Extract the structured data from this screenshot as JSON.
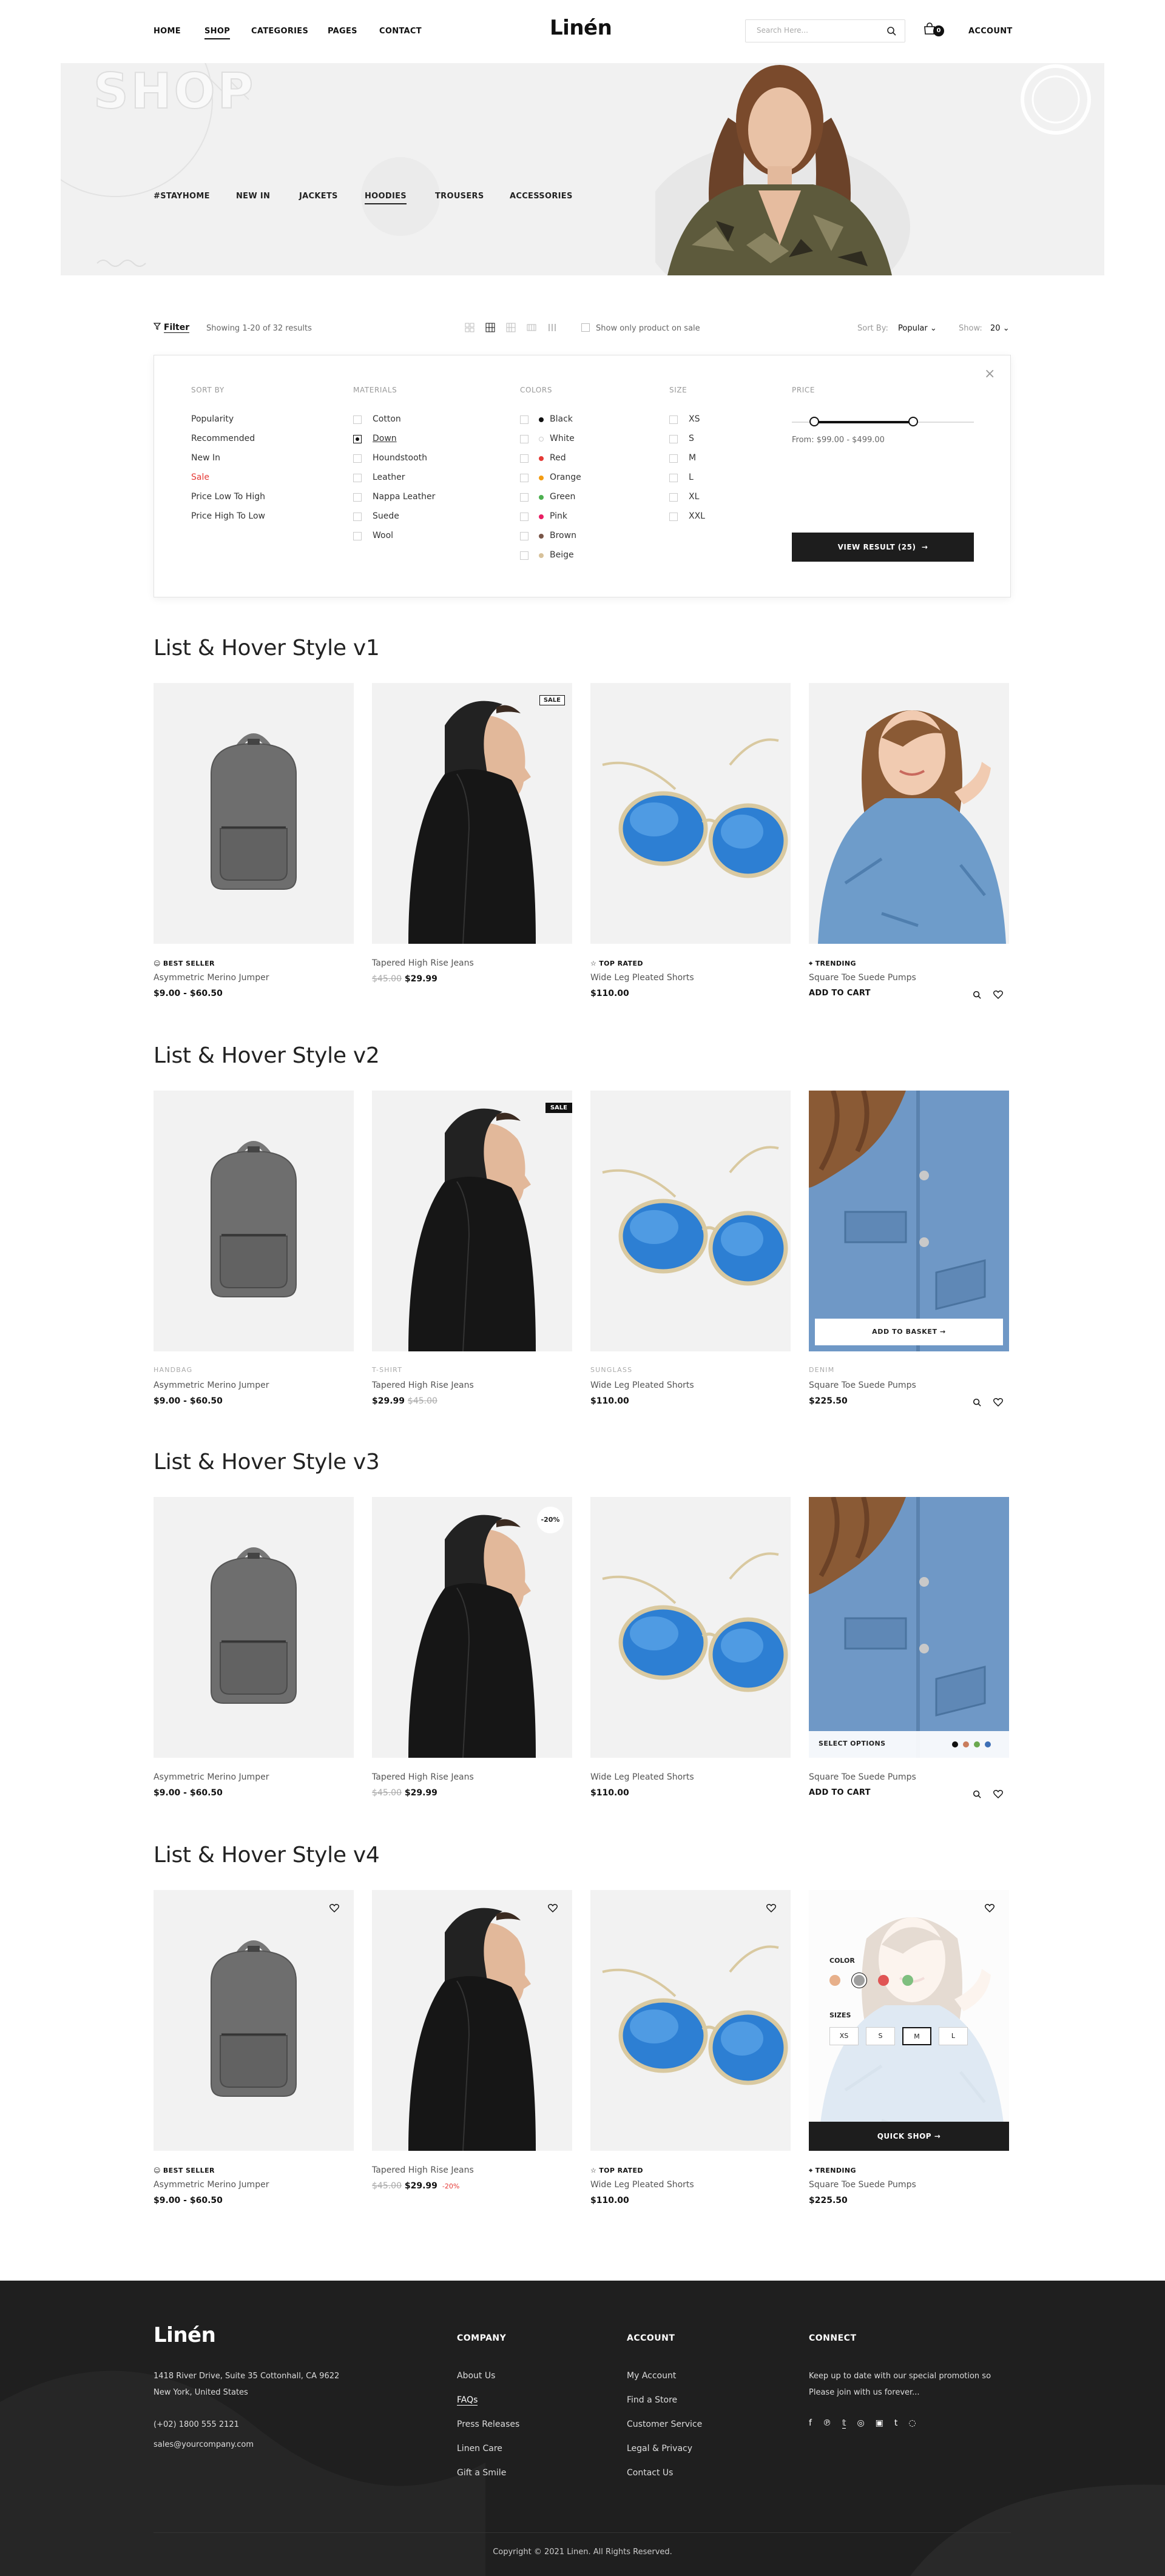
{
  "header": {
    "nav": [
      "HOME",
      "SHOP",
      "CATEGORIES",
      "PAGES",
      "CONTACT"
    ],
    "logo": "Linén",
    "search_placeholder": "Search Here...",
    "cart_count": "0",
    "account": "ACCOUNT"
  },
  "hero": {
    "title": "SHOP",
    "categories": [
      "#STAYHOME",
      "NEW IN",
      "JACKETS",
      "HOODIES",
      "TROUSERS",
      "ACCESSORIES"
    ]
  },
  "toolbar": {
    "filter": "Filter",
    "results": "Showing 1-20 of 32 results",
    "sale_only": "Show only product on sale",
    "sort_label": "Sort By:",
    "sort_value": "Popular",
    "show_label": "Show:",
    "show_value": "20"
  },
  "filters": {
    "sort_title": "SORT BY",
    "sort": [
      "Popularity",
      "Recommended",
      "New In",
      "Sale",
      "Price Low To High",
      "Price High To Low"
    ],
    "materials_title": "MATERIALS",
    "materials": [
      "Cotton",
      "Down",
      "Houndstooth",
      "Leather",
      "Nappa Leather",
      "Suede",
      "Wool"
    ],
    "colors_title": "COLORS",
    "colors": [
      "Black",
      "White",
      "Red",
      "Orange",
      "Green",
      "Pink",
      "Brown",
      "Beige"
    ],
    "color_values": [
      "#111111",
      "#ffffff",
      "#e53935",
      "#f39c12",
      "#4caf50",
      "#e91e63",
      "#795548",
      "#d7c19a"
    ],
    "size_title": "SIZE",
    "sizes": [
      "XS",
      "S",
      "M",
      "L",
      "XL",
      "XXL"
    ],
    "price_title": "PRICE",
    "price_range": "From: $99.00 - $499.00",
    "view_result": "VIEW RESULT (25)"
  },
  "sections": [
    {
      "title": "List & Hover Style v1"
    },
    {
      "title": "List & Hover Style v2"
    },
    {
      "title": "List & Hover Style v3"
    },
    {
      "title": "List & Hover Style v4"
    }
  ],
  "products": {
    "backpack": {
      "name": "Asymmetric Merino Jumper",
      "price": "$9.00 - $60.50",
      "tag": "HANDBAG"
    },
    "hoodie": {
      "name": "Tapered High Rise Jeans",
      "price": "$29.99",
      "old": "$45.00",
      "tag": "T-SHIRT"
    },
    "glasses": {
      "name": "Wide Leg Pleated Shorts",
      "price": "$110.00",
      "tag": "SUNGLASS"
    },
    "jacket": {
      "name": "Square Toe Suede Pumps",
      "price": "$225.50",
      "tag": "DENIM"
    }
  },
  "labels": {
    "best_seller": "BEST SELLER",
    "top_rated": "TOP RATED",
    "trending": "TRENDING",
    "add_to_cart": "ADD TO CART",
    "add_to_basket": "ADD TO BASKET",
    "sale": "SALE",
    "discount": "-20%",
    "select_options": "SELECT OPTIONS",
    "color": "COLOR",
    "sizes": "SIZES",
    "size_options": [
      "XS",
      "S",
      "M",
      "L"
    ],
    "quick_shop": "QUICK SHOP",
    "swatches_v3": [
      "#111111",
      "#c97d5d",
      "#6aa84f",
      "#3d6fb6"
    ],
    "swatches_v4": [
      "#e7b08b",
      "#9e9e9e",
      "#e05555",
      "#7fbf7f"
    ]
  },
  "footer": {
    "logo": "Linén",
    "address1": "1418 River Drive, Suite 35 Cottonhall, CA 9622",
    "address2": "New York, United States",
    "phone": "(+02) 1800 555 2121",
    "email": "sales@yourcompany.com",
    "company_title": "COMPANY",
    "company": [
      "About Us",
      "FAQs",
      "Press Releases",
      "Linen Care",
      "Gift a Smile"
    ],
    "account_title": "ACCOUNT",
    "account": [
      "My Account",
      "Find a Store",
      "Customer Service",
      "Legal & Privacy",
      "Contact Us"
    ],
    "connect_title": "CONNECT",
    "connect_text1": "Keep up to date with our special promotion so",
    "connect_text2": "Please join with us forever...",
    "copyright": "Copyright © 2021 Linen. All Rights Reserved."
  }
}
